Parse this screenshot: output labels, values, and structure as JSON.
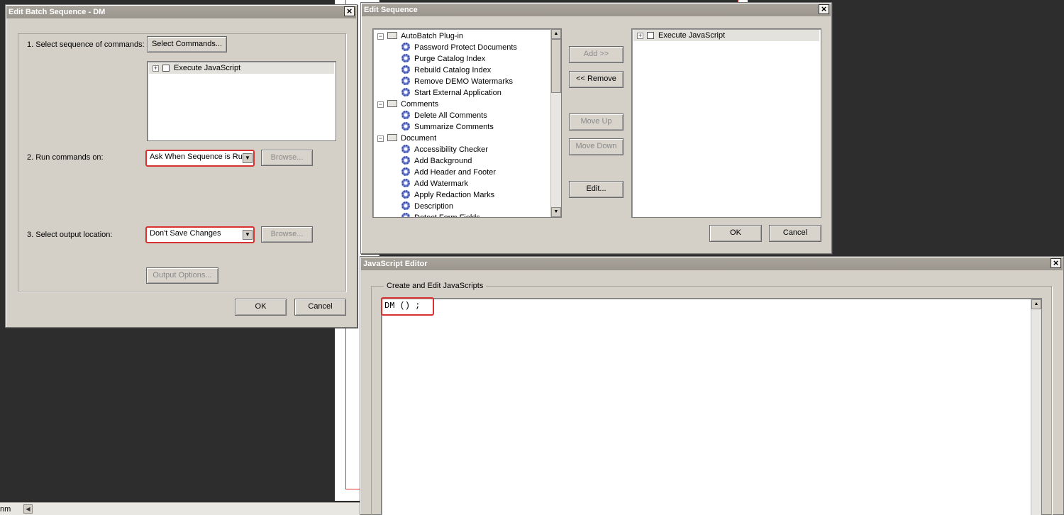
{
  "status_bar": {
    "unit": "nm"
  },
  "batch_window": {
    "title": "Edit Batch Sequence - DM",
    "step1_label": "1. Select sequence of commands:",
    "select_commands_button": "Select Commands...",
    "commands": [
      {
        "label": "Execute JavaScript",
        "checked": false
      }
    ],
    "step2_label": "2. Run commands on:",
    "run_on_value": "Ask When Sequence is Run",
    "browse_label": "Browse...",
    "step3_label": "3. Select output location:",
    "output_value": "Don't Save Changes",
    "output_options_button": "Output Options...",
    "ok": "OK",
    "cancel": "Cancel"
  },
  "sequence_window": {
    "title": "Edit Sequence",
    "tree": [
      {
        "type": "folder",
        "label": "AutoBatch Plug-in"
      },
      {
        "type": "item",
        "label": "Password Protect Documents"
      },
      {
        "type": "item",
        "label": "Purge Catalog Index"
      },
      {
        "type": "item",
        "label": "Rebuild Catalog Index"
      },
      {
        "type": "item",
        "label": "Remove DEMO Watermarks"
      },
      {
        "type": "item",
        "label": "Start External Application"
      },
      {
        "type": "folder",
        "label": "Comments"
      },
      {
        "type": "item",
        "label": "Delete All Comments"
      },
      {
        "type": "item",
        "label": "Summarize Comments"
      },
      {
        "type": "folder",
        "label": "Document"
      },
      {
        "type": "item",
        "label": "Accessibility Checker"
      },
      {
        "type": "item",
        "label": "Add Background"
      },
      {
        "type": "item",
        "label": "Add Header and Footer"
      },
      {
        "type": "item",
        "label": "Add Watermark"
      },
      {
        "type": "item",
        "label": "Apply Redaction Marks"
      },
      {
        "type": "item",
        "label": "Description"
      },
      {
        "type": "item",
        "label": "Detect Form Fields"
      }
    ],
    "add_button": "Add >>",
    "remove_button": "<< Remove",
    "move_up_button": "Move Up",
    "move_down_button": "Move Down",
    "edit_button": "Edit...",
    "selected": [
      {
        "label": "Execute JavaScript",
        "checked": false
      }
    ],
    "ok": "OK",
    "cancel": "Cancel"
  },
  "js_window": {
    "title": "JavaScript Editor",
    "group_label": "Create and Edit JavaScripts",
    "code": "DM () ;"
  }
}
